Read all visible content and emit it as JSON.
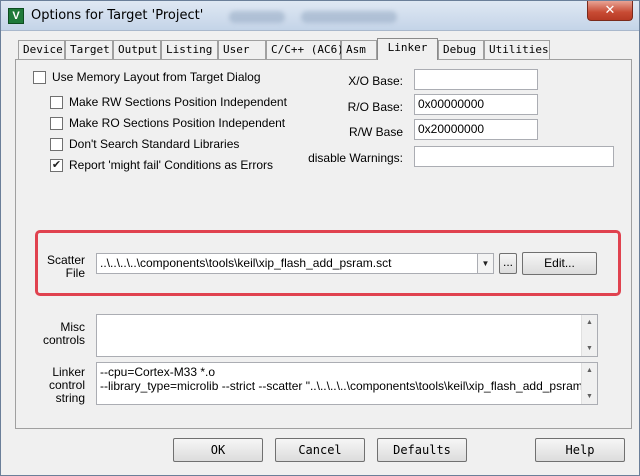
{
  "window": {
    "title": "Options for Target 'Project'",
    "close_glyph": "✕",
    "app_icon_letter": "V"
  },
  "tabs": [
    "Device",
    "Target",
    "Output",
    "Listing",
    "User",
    "C/C++ (AC6)",
    "Asm",
    "Linker",
    "Debug",
    "Utilities"
  ],
  "active_tab": "Linker",
  "options": {
    "use_memory_layout": {
      "label": "Use Memory Layout from Target Dialog",
      "checked": false
    },
    "make_rw_independent": {
      "label": "Make RW Sections Position Independent",
      "checked": false
    },
    "make_ro_independent": {
      "label": "Make RO Sections Position Independent",
      "checked": false
    },
    "dont_search_libs": {
      "label": "Don't Search Standard Libraries",
      "checked": false
    },
    "might_fail_errors": {
      "label": "Report 'might fail' Conditions as Errors",
      "checked": true
    }
  },
  "fields": {
    "xo_base": {
      "label": "X/O Base:",
      "value": ""
    },
    "ro_base": {
      "label": "R/O Base:",
      "value": "0x00000000"
    },
    "rw_base": {
      "label": "R/W Base",
      "value": "0x20000000"
    },
    "disable_warnings": {
      "label": "disable Warnings:",
      "value": ""
    }
  },
  "scatter": {
    "label_line1": "Scatter",
    "label_line2": "File",
    "value": "..\\..\\..\\..\\components\\tools\\keil\\xip_flash_add_psram.sct",
    "browse_label": "...",
    "edit_label": "Edit..."
  },
  "misc": {
    "label_line1": "Misc",
    "label_line2": "controls",
    "value": ""
  },
  "linker_string": {
    "label_line1": "Linker",
    "label_line2": "control",
    "label_line3": "string",
    "lines": [
      "--cpu=Cortex-M33 *.o",
      "--library_type=microlib --strict --scatter \"..\\..\\..\\..\\components\\tools\\keil\\xip_flash_add_psram.sct\""
    ]
  },
  "buttons": {
    "ok": "OK",
    "cancel": "Cancel",
    "defaults": "Defaults",
    "help": "Help"
  },
  "colors": {
    "highlight_frame": "#e0424f",
    "title_gradient_top": "#dfe8f3"
  }
}
